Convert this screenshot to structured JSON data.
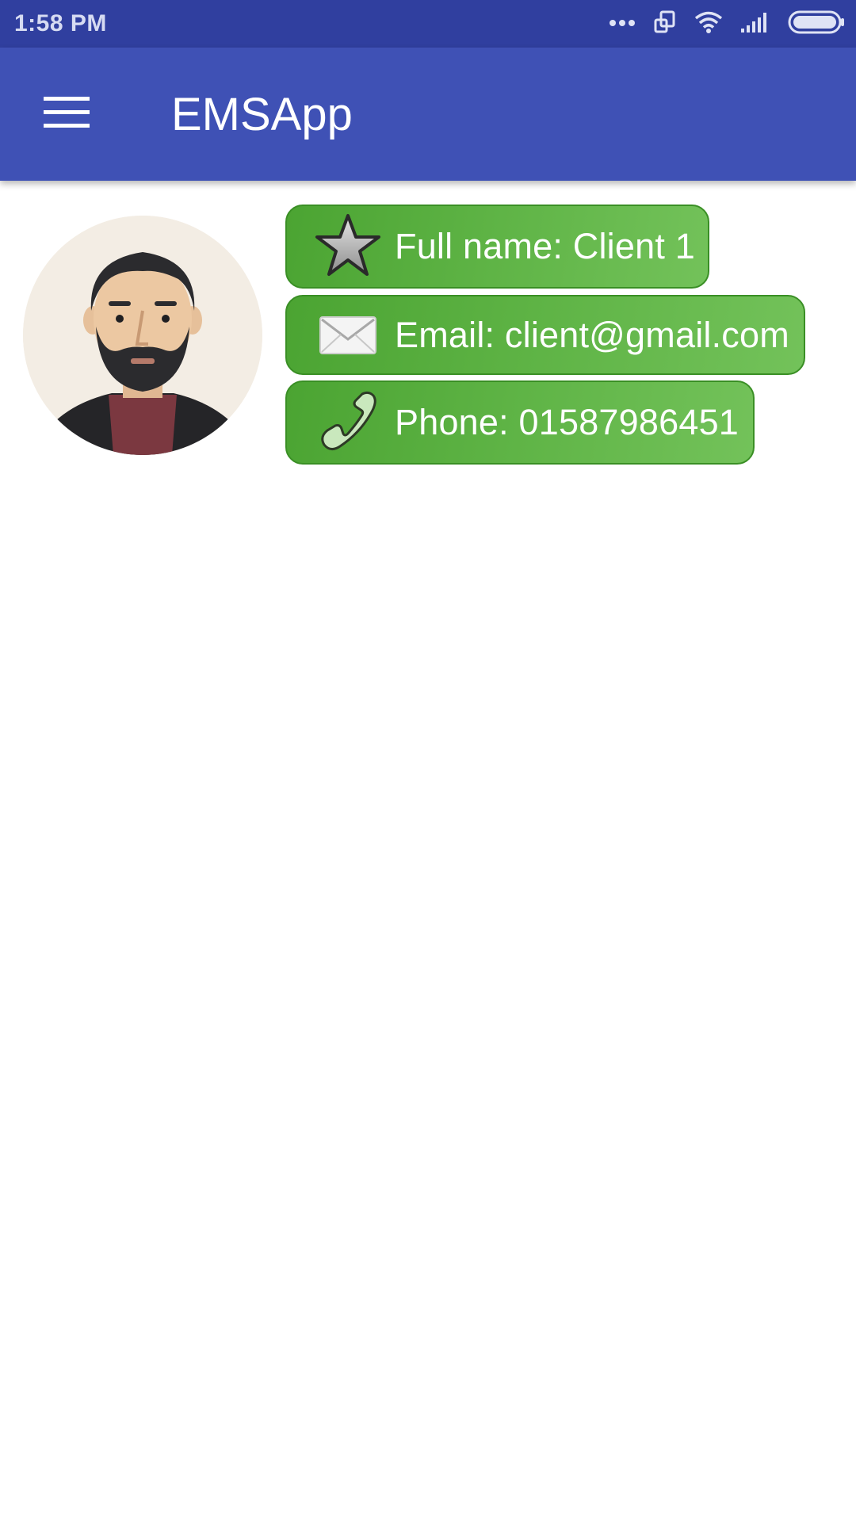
{
  "status_bar": {
    "time": "1:58 PM",
    "icons": [
      "more-dots-icon",
      "screen-rotate-icon",
      "wifi-icon",
      "signal-icon",
      "battery-icon"
    ]
  },
  "app_bar": {
    "title": "EMSApp",
    "menu_icon": "hamburger-menu-icon",
    "color": "#3F51B5"
  },
  "profile": {
    "avatar_icon": "user-avatar",
    "full_name": "Full name: Client 1",
    "email": "Email: client@gmail.com",
    "phone": "Phone: 01587986451",
    "icons": {
      "name": "star-icon",
      "email": "envelope-icon",
      "phone": "phone-icon"
    },
    "pill_color": "#5fb446"
  }
}
